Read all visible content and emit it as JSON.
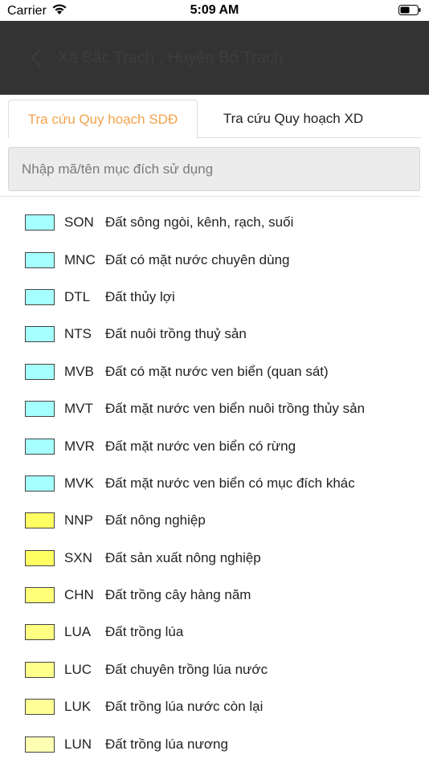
{
  "status_bar": {
    "carrier": "Carrier",
    "time": "5:09 AM"
  },
  "nav": {
    "title": "Xã Bắc Trạch , Huyện Bố Trạch"
  },
  "tabs": [
    {
      "label": "Tra cứu Quy hoạch SDĐ",
      "active": true
    },
    {
      "label": "Tra cứu Quy hoạch XD",
      "active": false
    }
  ],
  "search": {
    "placeholder": "Nhập mã/tên mục đích sử dụng",
    "value": ""
  },
  "colors": {
    "accent": "#f3a24a",
    "nav_bg": "#333333",
    "water": "#a6ffff",
    "agri_1": "#ffff55",
    "agri_2": "#ffff7a",
    "agri_3": "#ffff99",
    "agri_4": "#ffffb0"
  },
  "items": [
    {
      "code": "SON",
      "name": "Đất sông ngòi, kênh, rạch, suối",
      "color": "#a6ffff"
    },
    {
      "code": "MNC",
      "name": "Đất có mặt nước chuyên dùng",
      "color": "#a6ffff"
    },
    {
      "code": "DTL",
      "name": "Đất thủy lợi",
      "color": "#a6ffff"
    },
    {
      "code": "NTS",
      "name": "Đất nuôi trồng thuỷ sản",
      "color": "#a6ffff"
    },
    {
      "code": "MVB",
      "name": "Đất có mặt nước ven biển (quan sát)",
      "color": "#a6ffff"
    },
    {
      "code": "MVT",
      "name": "Đất mặt nước ven biển nuôi trồng thủy sản",
      "color": "#a6ffff"
    },
    {
      "code": "MVR",
      "name": "Đất mặt nước ven biển có rừng",
      "color": "#a6ffff"
    },
    {
      "code": "MVK",
      "name": "Đất mặt nước ven biển có mục đích khác",
      "color": "#a6ffff"
    },
    {
      "code": "NNP",
      "name": "Đất nông nghiệp",
      "color": "#ffff64"
    },
    {
      "code": "SXN",
      "name": "Đất sản xuất nông nghiệp",
      "color": "#ffff64"
    },
    {
      "code": "CHN",
      "name": "Đất trồng cây hàng năm",
      "color": "#ffff78"
    },
    {
      "code": "LUA",
      "name": "Đất trồng lúa",
      "color": "#ffff82"
    },
    {
      "code": "LUC",
      "name": "Đất chuyên trồng lúa nước",
      "color": "#ffff8c"
    },
    {
      "code": "LUK",
      "name": "Đất trồng lúa nước còn lại",
      "color": "#ffff96"
    },
    {
      "code": "LUN",
      "name": "Đất trồng lúa nương",
      "color": "#ffffb4"
    }
  ]
}
